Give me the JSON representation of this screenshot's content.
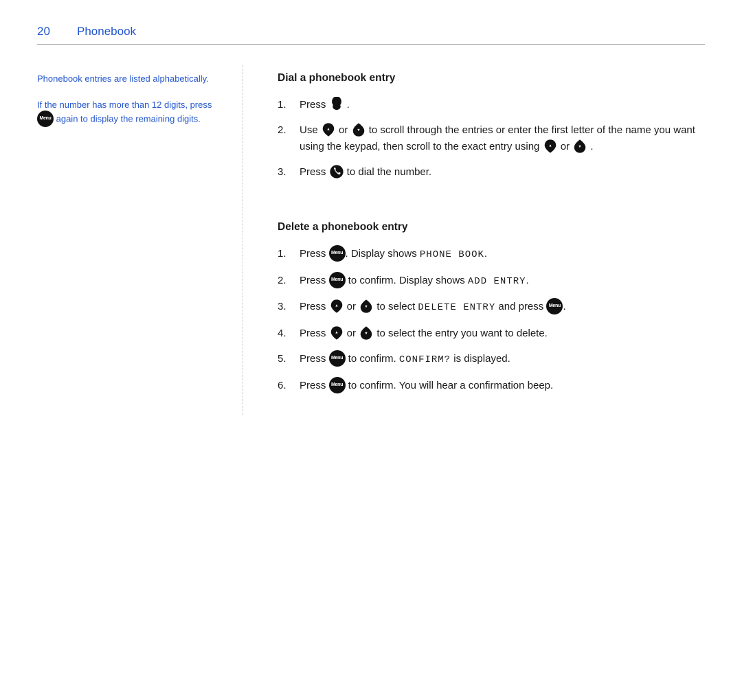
{
  "header": {
    "page_number": "20",
    "title": "Phonebook",
    "rule": true
  },
  "sidebar": {
    "note1": "Phonebook entries are listed alphabetically.",
    "note2": "If the number has more than 12 digits, press",
    "note2b": "again to display the remaining digits."
  },
  "sections": [
    {
      "id": "dial",
      "title": "Dial a phonebook entry",
      "steps": [
        {
          "num": "1.",
          "text": "Press [phone-icon]."
        },
        {
          "num": "2.",
          "text": "Use [up-icon] or [down-icon] to scroll through the entries or enter the first letter of the name you want using the keypad, then scroll to the exact entry using [up-icon] or [down-icon]."
        },
        {
          "num": "3.",
          "text": "Press [call-icon] to dial the number."
        }
      ]
    },
    {
      "id": "delete",
      "title": "Delete a phonebook entry",
      "steps": [
        {
          "num": "1.",
          "text": "Press [menu-icon]. Display shows PHONE BOOK."
        },
        {
          "num": "2.",
          "text": "Press [menu-icon] to confirm. Display shows ADD ENTRY."
        },
        {
          "num": "3.",
          "text": "Press [up-icon] or [down-icon] to select DELETE ENTRY and press [menu-icon]."
        },
        {
          "num": "4.",
          "text": "Press [up-icon] or [down-icon] to select the entry you want to delete."
        },
        {
          "num": "5.",
          "text": "Press [menu-icon] to confirm. CONFIRM? is displayed."
        },
        {
          "num": "6.",
          "text": "Press [menu-icon] to confirm. You will hear a confirmation beep."
        }
      ]
    }
  ]
}
